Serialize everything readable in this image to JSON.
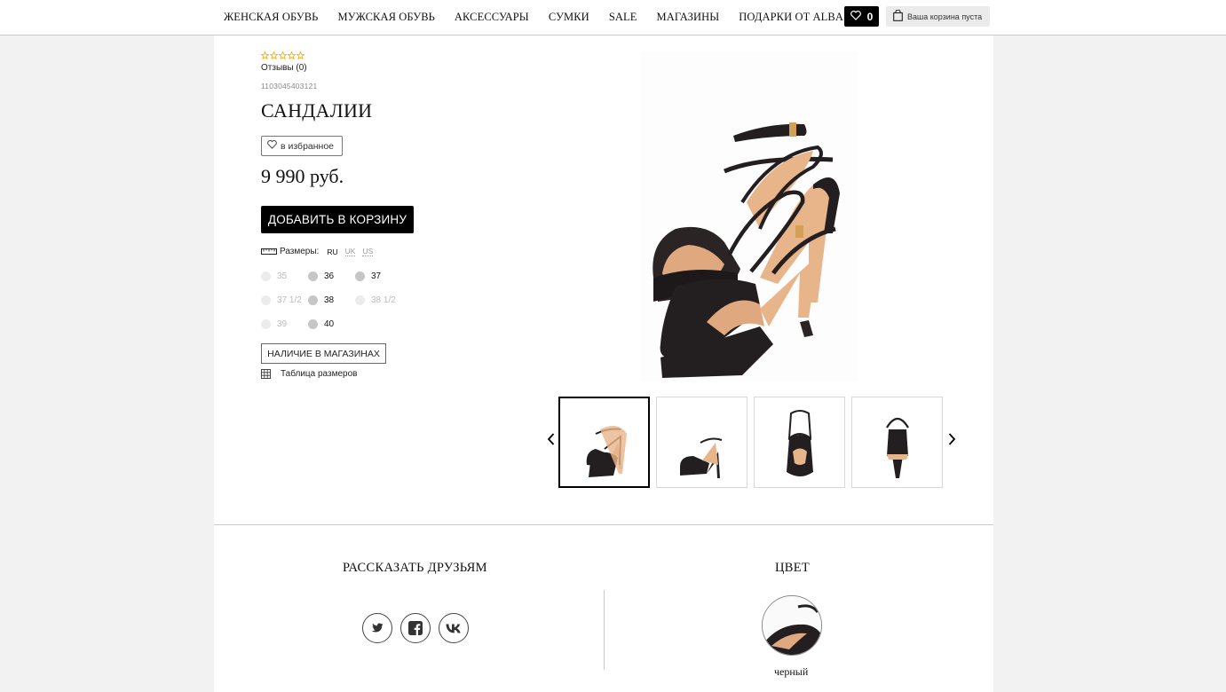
{
  "nav": {
    "items": [
      "ЖЕНСКАЯ ОБУВЬ",
      "МУЖСКАЯ ОБУВЬ",
      "АКСЕССУАРЫ",
      "СУМКИ",
      "SALE",
      "МАГАЗИНЫ",
      "ПОДАРКИ ОТ ALBA"
    ],
    "favorites_count": "0",
    "cart_text": "Ваша корзина пуста"
  },
  "product": {
    "rating": 0,
    "reviews_label": "Отзывы (0)",
    "sku": "1103045403121",
    "title": "САНДАЛИИ",
    "favorite_label": "в избранное",
    "price": "9 990 руб.",
    "add_to_cart_label": "ДОБАВИТЬ В КОРЗИНУ",
    "sizes_label": "Размеры:",
    "size_systems": [
      "RU",
      "UK",
      "US"
    ],
    "sizes": [
      {
        "label": "35",
        "available": false
      },
      {
        "label": "36",
        "available": true
      },
      {
        "label": "37",
        "available": true
      },
      {
        "label": "37 1/2",
        "available": false
      },
      {
        "label": "38",
        "available": true
      },
      {
        "label": "38 1/2",
        "available": false
      },
      {
        "label": "39",
        "available": false
      },
      {
        "label": "40",
        "available": true
      }
    ],
    "availability_label": "НАЛИЧИЕ В МАГАЗИНАХ",
    "size_table_label": "Таблица размеров"
  },
  "gallery": {
    "thumbnail_count": 4,
    "active_index": 0
  },
  "share": {
    "title": "РАССКАЗАТЬ ДРУЗЬЯМ",
    "networks": [
      "twitter-icon",
      "facebook-icon",
      "vk-icon"
    ]
  },
  "color": {
    "title": "ЦВЕТ",
    "name": "черный"
  },
  "colors": {
    "accent": "#000000",
    "star": "#f2a900"
  }
}
